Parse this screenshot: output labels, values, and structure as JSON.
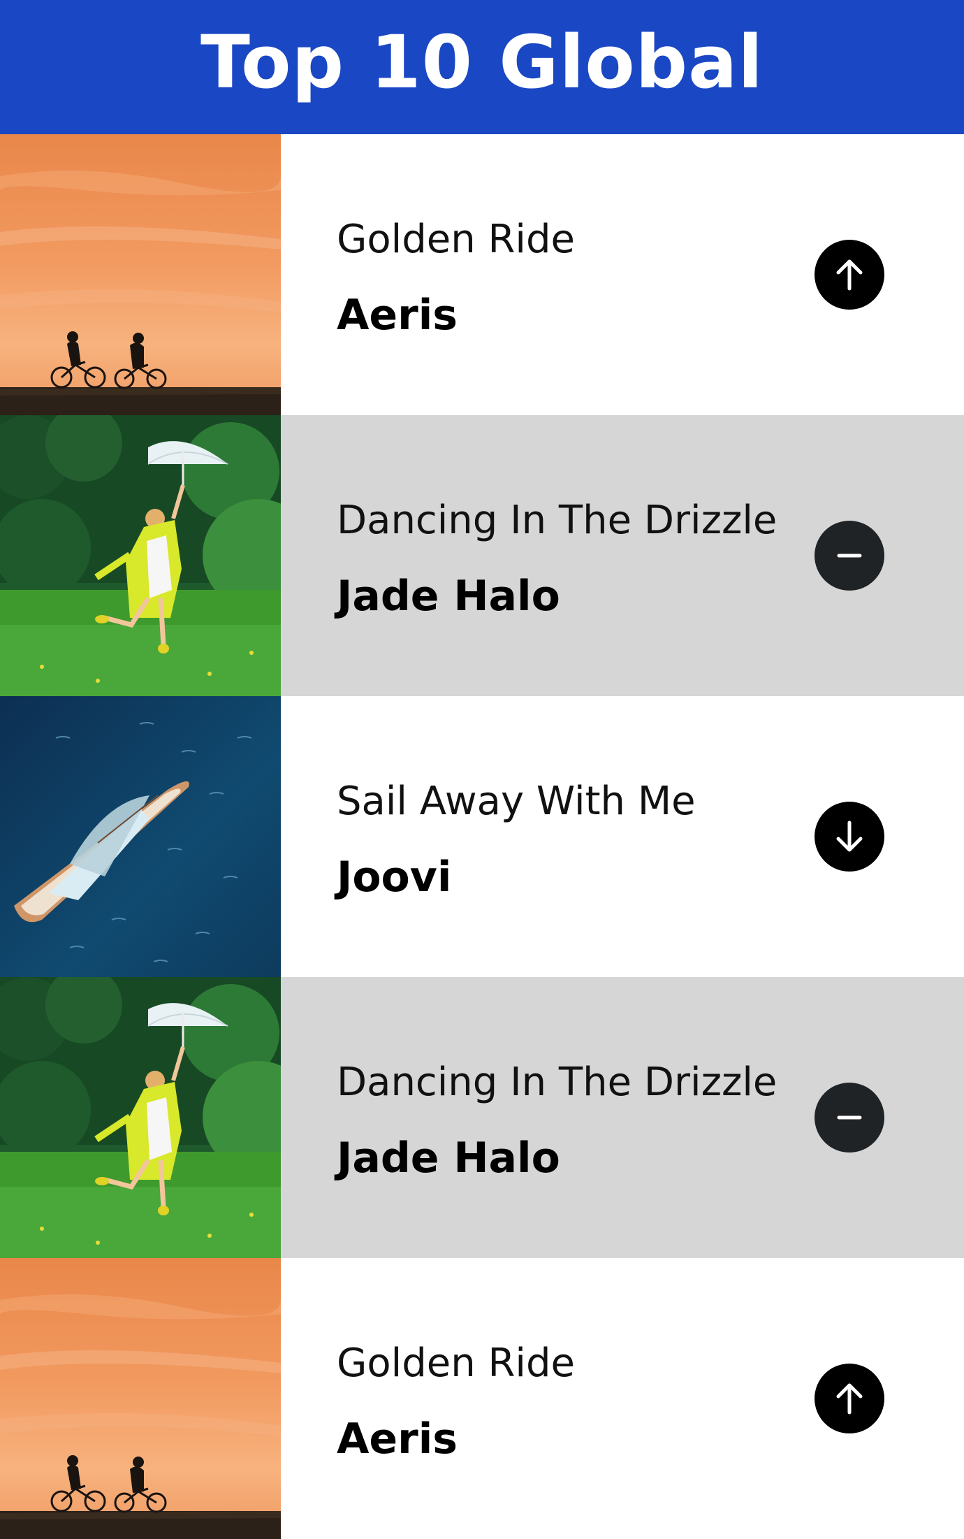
{
  "header": {
    "title": "Top 10 Global"
  },
  "colors": {
    "header_bg": "#1a47c4",
    "alt_row": "#d6d6d6",
    "icon_bg": "#000000"
  },
  "tracks": [
    {
      "title": "Golden Ride",
      "artist": "Aeris",
      "artwork": "sunset-cyclists-image",
      "trend": "up",
      "trend_icon": "arrow-up-icon"
    },
    {
      "title": "Dancing In The Drizzle",
      "artist": "Jade Halo",
      "artwork": "umbrella-dancer-image",
      "trend": "same",
      "trend_icon": "minus-icon"
    },
    {
      "title": "Sail Away With Me",
      "artist": "Joovi",
      "artwork": "sailboat-ocean-image",
      "trend": "down",
      "trend_icon": "arrow-down-icon"
    },
    {
      "title": "Dancing In The Drizzle",
      "artist": "Jade Halo",
      "artwork": "umbrella-dancer-image",
      "trend": "same",
      "trend_icon": "minus-icon"
    },
    {
      "title": "Golden Ride",
      "artist": "Aeris",
      "artwork": "sunset-cyclists-image",
      "trend": "up",
      "trend_icon": "arrow-up-icon"
    }
  ]
}
